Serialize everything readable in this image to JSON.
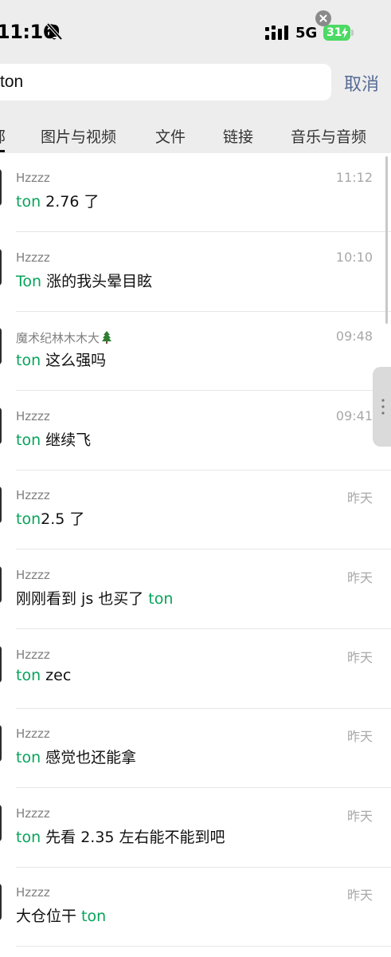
{
  "status_bar": {
    "time": "11:16",
    "network": "5G",
    "battery": "31"
  },
  "search": {
    "query": "ton",
    "cancel_label": "取消"
  },
  "tabs": [
    {
      "label": "部",
      "active": true
    },
    {
      "label": "图片与视频"
    },
    {
      "label": "文件"
    },
    {
      "label": "链接"
    },
    {
      "label": "音乐与音频"
    }
  ],
  "results": [
    {
      "sender": "Hzzzz",
      "time": "11:12",
      "message": [
        {
          "text": "ton",
          "hl": true
        },
        {
          "text": "  2.76 了"
        }
      ]
    },
    {
      "sender": "Hzzzz",
      "time": "10:10",
      "message": [
        {
          "text": "Ton",
          "hl": true
        },
        {
          "text": " 涨的我头晕目眩"
        }
      ]
    },
    {
      "sender": "魔术纪林木木大",
      "sender_icon": "tree-icon",
      "time": "09:48",
      "message": [
        {
          "text": "ton",
          "hl": true
        },
        {
          "text": " 这么强吗"
        }
      ]
    },
    {
      "sender": "Hzzzz",
      "time": "09:41",
      "message": [
        {
          "text": "ton",
          "hl": true
        },
        {
          "text": " 继续飞"
        }
      ]
    },
    {
      "sender": "Hzzzz",
      "time": "昨天",
      "message": [
        {
          "text": "ton",
          "hl": true
        },
        {
          "text": "2.5 了"
        }
      ]
    },
    {
      "sender": "Hzzzz",
      "time": "昨天",
      "message": [
        {
          "text": "刚刚看到 js 也买了 "
        },
        {
          "text": "ton",
          "hl": true
        }
      ]
    },
    {
      "sender": "Hzzzz",
      "time": "昨天",
      "message": [
        {
          "text": "ton",
          "hl": true
        },
        {
          "text": " zec"
        }
      ]
    },
    {
      "sender": "Hzzzz",
      "time": "昨天",
      "message": [
        {
          "text": "ton",
          "hl": true
        },
        {
          "text": " 感觉也还能拿"
        }
      ]
    },
    {
      "sender": "Hzzzz",
      "time": "昨天",
      "message": [
        {
          "text": "ton",
          "hl": true
        },
        {
          "text": " 先看 2.35 左右能不能到吧"
        }
      ]
    },
    {
      "sender": "Hzzzz",
      "time": "昨天",
      "message": [
        {
          "text": "大仓位干 "
        },
        {
          "text": "ton",
          "hl": true
        }
      ]
    }
  ],
  "colors": {
    "highlight": "#07a35a",
    "link": "#576b95",
    "battery": "#4cd964"
  }
}
